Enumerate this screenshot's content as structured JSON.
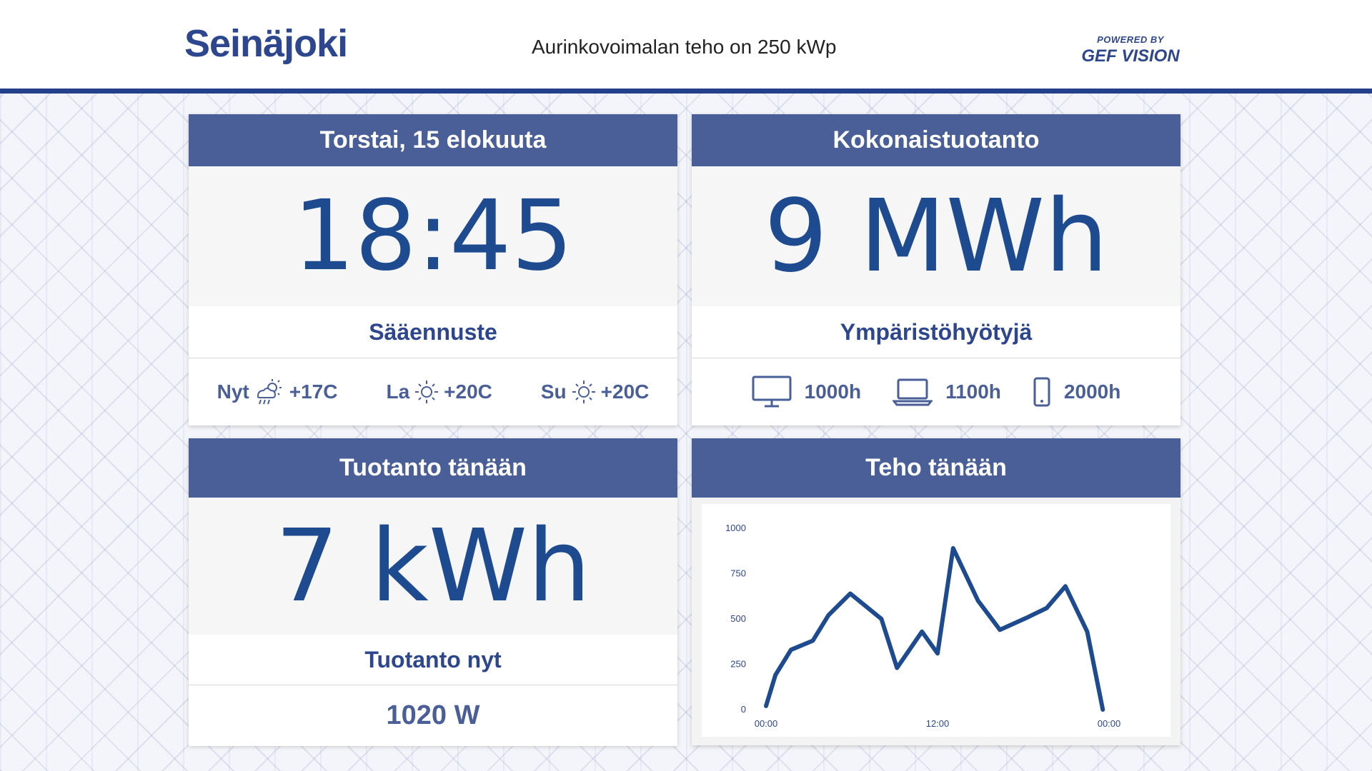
{
  "header": {
    "logo": "Seinäjoki",
    "tagline": "Aurinkovoimalan teho on 250 kWp",
    "powered_small": "POWERED BY",
    "powered_brand": "GEF VISION"
  },
  "date_card": {
    "title": "Torstai, 15 elokuuta",
    "time": "18:45",
    "subtitle": "Sääennuste",
    "forecast": [
      {
        "day": "Nyt",
        "icon": "rain-cloud-sun-icon",
        "temp": "+17C"
      },
      {
        "day": "La",
        "icon": "sun-icon",
        "temp": "+20C"
      },
      {
        "day": "Su",
        "icon": "sun-icon",
        "temp": "+20C"
      }
    ]
  },
  "total_card": {
    "title": "Kokonaistuotanto",
    "value": "9 MWh",
    "subtitle": "Ympäristöhyötyjä",
    "equivalents": [
      {
        "icon": "monitor-icon",
        "value": "1000h"
      },
      {
        "icon": "laptop-icon",
        "value": "1100h"
      },
      {
        "icon": "phone-icon",
        "value": "2000h"
      }
    ]
  },
  "today_card": {
    "title": "Tuotanto tänään",
    "value": "7 kWh",
    "subtitle": "Tuotanto nyt",
    "now_value": "1020 W"
  },
  "power_card": {
    "title": "Teho tänään"
  },
  "chart_data": {
    "type": "line",
    "title": "",
    "xlabel": "",
    "ylabel": "",
    "x_ticks": [
      "00:00",
      "12:00",
      "00:00"
    ],
    "y_ticks": [
      0,
      250,
      500,
      750,
      1000
    ],
    "ylim": [
      0,
      1000
    ],
    "x": [
      0,
      0.3,
      0.8,
      1.5,
      2.0,
      2.7,
      3.7,
      4.2,
      5.0,
      5.5,
      6.0,
      6.8,
      7.5,
      8.4,
      9.0,
      9.6,
      10.3,
      10.8
    ],
    "series": [
      {
        "values": [
          20,
          190,
          330,
          380,
          520,
          640,
          500,
          230,
          430,
          310,
          890,
          600,
          440,
          510,
          560,
          680,
          430,
          0
        ]
      }
    ],
    "grid": false,
    "color": "#1e4b8f"
  },
  "colors": {
    "accent": "#23418a",
    "header_bg": "#4a5f97",
    "value_text": "#1e4b8f"
  }
}
